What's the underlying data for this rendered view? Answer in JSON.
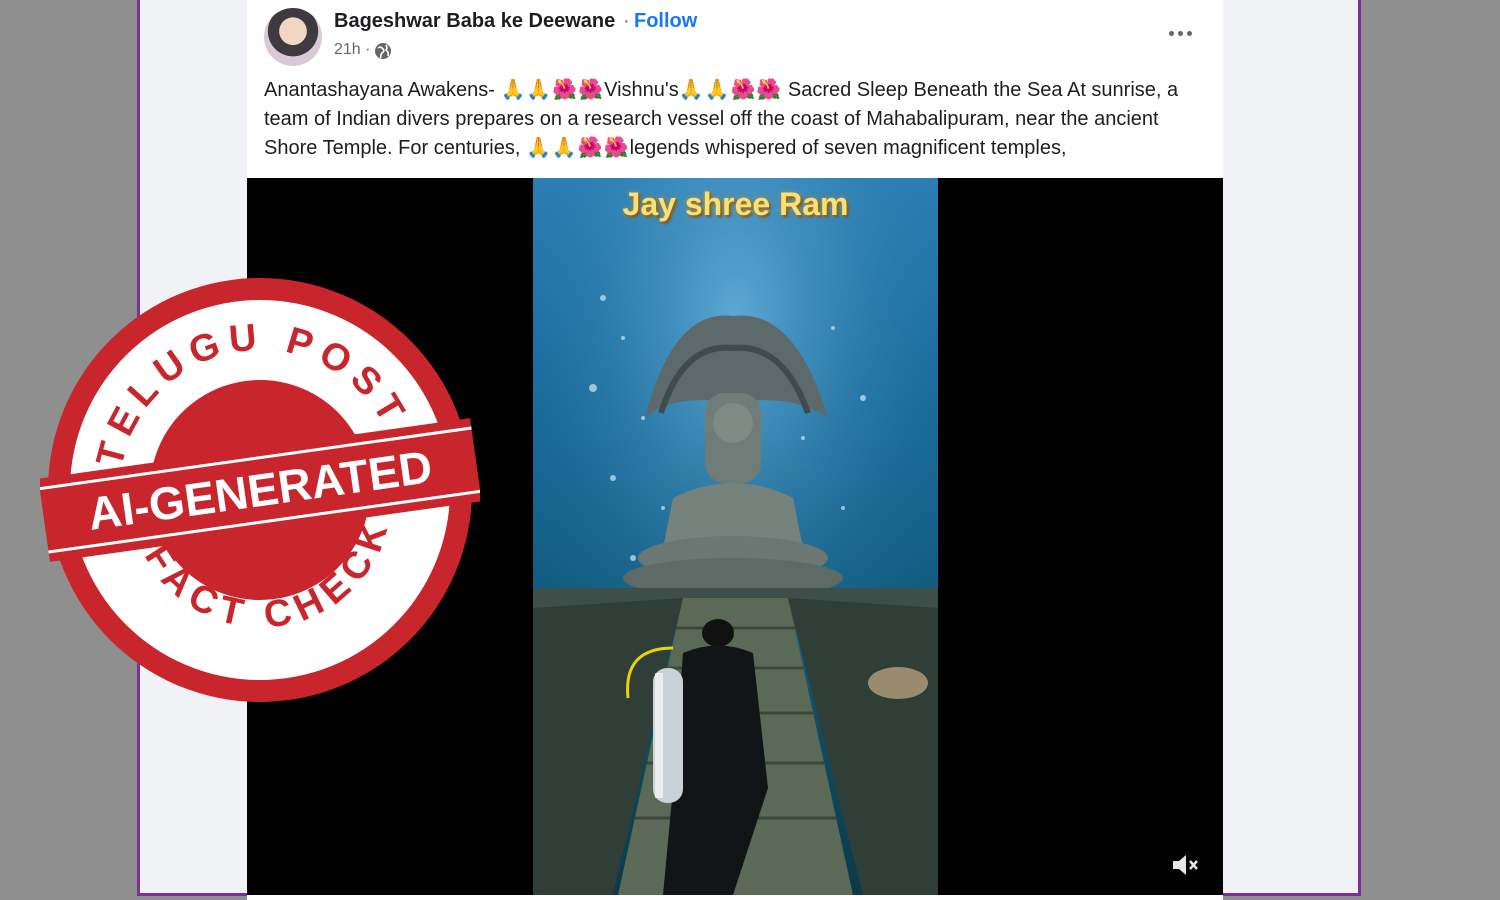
{
  "post": {
    "author": "Bageshwar Baba ke Deewane",
    "separator": "·",
    "follow_label": "Follow",
    "time": "21h ·",
    "caption": {
      "part1": "Anantashayana Awakens-",
      "emoji1": "🙏🙏🌺🌺",
      "part2": "Vishnu's",
      "emoji2": "🙏🙏🌺🌺",
      "part3": "Sacred Sleep Beneath the Sea At sunrise, a team of Indian divers prepares on a research vessel off the coast of Mahabalipuram, near the ancient Shore Temple. For centuries,",
      "emoji3": "🙏🙏🌺🌺",
      "part4": "legends whispered of seven magnificent temples,"
    }
  },
  "video": {
    "overlay_text": "Jay shree Ram"
  },
  "stamp": {
    "top_text": "TELUGU POST",
    "banner_text": "AI-GENERATED",
    "bottom_text": "FACT CHECK"
  },
  "colors": {
    "follow": "#1877f2",
    "stamp_red": "#c8262c",
    "frame_border": "#7a2f9a"
  }
}
